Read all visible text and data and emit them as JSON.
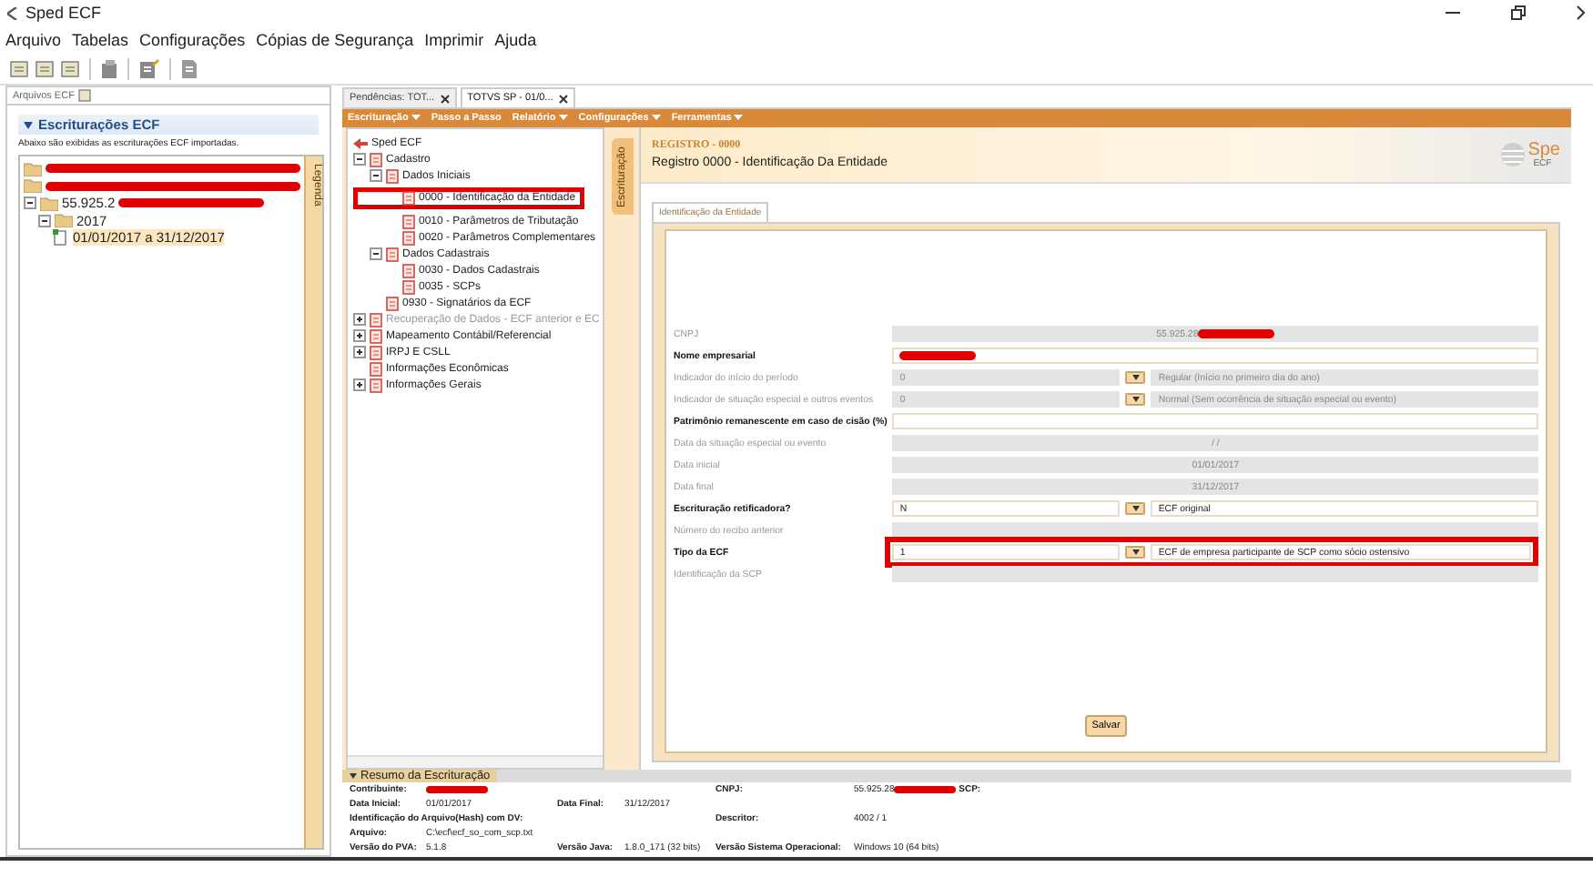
{
  "window": {
    "title": "Sped ECF"
  },
  "menu": [
    "Arquivo",
    "Tabelas",
    "Configurações",
    "Cópias de Segurança",
    "Imprimir",
    "Ajuda"
  ],
  "left_panel": {
    "tab": "Arquivos ECF",
    "header": "Escriturações ECF",
    "description": "Abaixo são exibidas as escriturações ECF importadas.",
    "side_tab": "Legenda",
    "tree": [
      {
        "kind": "folder",
        "redacted": true
      },
      {
        "kind": "folder",
        "redacted": true
      },
      {
        "kind": "folder",
        "label": "55.925.2",
        "redacted": true,
        "selected": false,
        "expanded": true,
        "children": [
          {
            "kind": "folder",
            "label": "2017",
            "redacted": false,
            "selected": false,
            "expanded": true,
            "children": [
              {
                "kind": "period",
                "label": "01/01/2017 a 31/12/2017",
                "redacted": false,
                "selected": true
              }
            ]
          }
        ]
      }
    ]
  },
  "editor": {
    "tabs": [
      {
        "label": "Pendências: TOT...",
        "selected": false
      },
      {
        "label": "TOTVS SP - 01/0...",
        "selected": true
      }
    ],
    "toolbar": [
      {
        "label": "Escrituração",
        "dropdown": true
      },
      {
        "label": "Passo a Passo",
        "dropdown": false
      },
      {
        "label": "Relatório",
        "dropdown": true
      },
      {
        "label": "Configurações",
        "dropdown": true
      },
      {
        "label": "Ferramentas",
        "dropdown": true
      }
    ],
    "nav_tree": [
      {
        "kind": "root",
        "label": "Sped ECF",
        "disabled": false,
        "children": [
          {
            "kind": "group",
            "label": "Cadastro",
            "expanded": true,
            "disabled": false,
            "children": [
              {
                "kind": "group",
                "label": "Dados Iniciais",
                "expanded": true,
                "disabled": false,
                "children": [
                  {
                    "kind": "record",
                    "label": "0000 - Identificação da Entidade",
                    "highlighted": true
                  },
                  {
                    "kind": "record",
                    "label": "0010 - Parâmetros de Tributação"
                  },
                  {
                    "kind": "record",
                    "label": "0020 - Parâmetros Complementares"
                  }
                ]
              },
              {
                "kind": "group",
                "label": "Dados Cadastrais",
                "expanded": true,
                "disabled": false,
                "children": [
                  {
                    "kind": "record",
                    "label": "0030 - Dados Cadastrais"
                  },
                  {
                    "kind": "record",
                    "label": "0035 - SCPs"
                  }
                ]
              },
              {
                "kind": "record",
                "label": "0930 - Signatários da ECF",
                "disabled": false
              }
            ]
          },
          {
            "kind": "group",
            "label": "Recuperação de Dados - ECF anterior e EC",
            "expanded": false,
            "disabled": true
          },
          {
            "kind": "group",
            "label": "Mapeamento Contábil/Referencial",
            "expanded": false,
            "disabled": false
          },
          {
            "kind": "group",
            "label": "IRPJ E CSLL",
            "expanded": false,
            "disabled": false
          },
          {
            "kind": "record",
            "label": "Informações Econômicas",
            "disabled": false
          },
          {
            "kind": "group",
            "label": "Informações Gerais",
            "expanded": false,
            "disabled": false
          }
        ]
      }
    ],
    "side_tab": "Escrituração",
    "record": {
      "code": "REGISTRO - 0000",
      "title": "Registro 0000 - Identificação Da Entidade",
      "logo": "Spe",
      "logo_sub": "ECF",
      "form_tab": "Identificação da Entidade",
      "fields": [
        {
          "kind": "text",
          "label": "CNPJ",
          "value": "55.925.28",
          "redacted": true,
          "disabled": true
        },
        {
          "kind": "text",
          "label": "Nome empresarial",
          "redacted": true,
          "disabled": false
        },
        {
          "kind": "combo",
          "label": "Indicador do início do período",
          "value": "0",
          "description": "Regular (Início no primeiro dia do ano)",
          "disabled": true
        },
        {
          "kind": "combo",
          "label": "Indicador de situação especial e outros eventos",
          "value": "0",
          "description": "Normal (Sem ocorrência de situação especial ou evento)",
          "disabled": true
        },
        {
          "kind": "text",
          "label": "Patrimônio remanescente em caso de cisão (%)",
          "redacted": false,
          "disabled": false
        },
        {
          "kind": "text",
          "label": "Data da situação especial ou evento",
          "value": "/ /",
          "redacted": false,
          "disabled": true
        },
        {
          "kind": "text",
          "label": "Data inicial",
          "value": "01/01/2017",
          "redacted": false,
          "disabled": true
        },
        {
          "kind": "text",
          "label": "Data final",
          "value": "31/12/2017",
          "redacted": false,
          "disabled": true
        },
        {
          "kind": "combo",
          "label": "Escrituração retificadora?",
          "value": "N",
          "description": "ECF original",
          "disabled": false
        },
        {
          "kind": "text",
          "label": "Número do recibo anterior",
          "redacted": false,
          "disabled": true
        },
        {
          "kind": "combo",
          "label": "Tipo da ECF",
          "value": "1",
          "description": "ECF de empresa participante de SCP como sócio ostensivo",
          "disabled": false,
          "highlighted": true
        },
        {
          "kind": "text",
          "label": "Identificação da SCP",
          "redacted": false,
          "disabled": true
        }
      ],
      "save_button": "Salvar"
    }
  },
  "summary": {
    "title": "Resumo da Escrituração",
    "rows": [
      [
        {
          "label": "Contribuinte:",
          "redacted": true
        },
        "",
        {
          "label": "CNPJ:",
          "value": "55.925.28",
          "redacted": true,
          "suffix": "SCP:"
        }
      ],
      [
        {
          "label": "Data Inicial:",
          "value": "01/01/2017",
          "redacted": false
        },
        {
          "label": "Data Final:",
          "value": "31/12/2017",
          "redacted": false
        }
      ],
      [
        {
          "label": "Identificação do Arquivo(Hash) com DV:",
          "redacted": false
        },
        "",
        {
          "label": "Descritor:",
          "value": "4002 / 1",
          "redacted": false
        }
      ],
      [
        {
          "label": "Arquivo:",
          "value": "C:\\ecf\\ecf_so_com_scp.txt",
          "redacted": false
        }
      ],
      [
        {
          "label": "Versão do PVA:",
          "value": "5.1.8",
          "redacted": false
        },
        {
          "label": "Versão Java:",
          "value": "1.8.0_171 (32 bits)",
          "redacted": false
        },
        {
          "label": "Versão Sistema Operacional:",
          "value": "Windows 10 (64 bits)",
          "redacted": false
        }
      ]
    ]
  }
}
